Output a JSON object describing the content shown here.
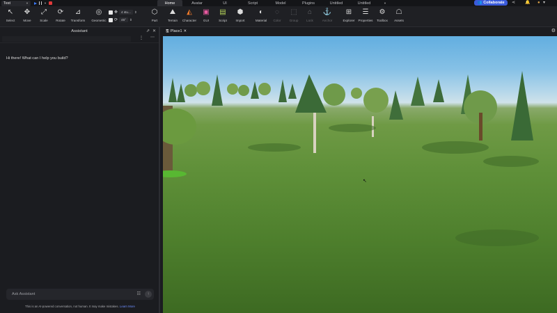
{
  "topbar": {
    "mode": "Test",
    "tabs": [
      {
        "label": "Home",
        "active": true
      },
      {
        "label": "Avatar",
        "active": false
      },
      {
        "label": "UI",
        "active": false
      },
      {
        "label": "Script",
        "active": false
      },
      {
        "label": "Model",
        "active": false
      },
      {
        "label": "Plugins",
        "active": false
      },
      {
        "label": "Untitled",
        "active": false
      },
      {
        "label": "Untitled",
        "active": false
      }
    ],
    "collaborate_label": "Collaborate"
  },
  "ribbon": {
    "tools": [
      {
        "label": "Select",
        "icon": "cursor-icon"
      },
      {
        "label": "Move",
        "icon": "move-arrows-icon"
      },
      {
        "label": "Scale",
        "icon": "scale-icon"
      },
      {
        "label": "Rotate",
        "icon": "rotate-icon"
      },
      {
        "label": "Transform",
        "icon": "transform-icon"
      },
      {
        "label": "Geometric",
        "icon": "geometric-icon"
      },
      {
        "label": "Part",
        "icon": "part-cube-icon"
      },
      {
        "label": "Terrain",
        "icon": "terrain-icon"
      },
      {
        "label": "Character",
        "icon": "character-icon"
      },
      {
        "label": "GUI",
        "icon": "gui-icon"
      },
      {
        "label": "Script",
        "icon": "script-icon"
      },
      {
        "label": "Import",
        "icon": "import-icon"
      },
      {
        "label": "Material",
        "icon": "material-icon"
      },
      {
        "label": "Color",
        "icon": "color-icon"
      },
      {
        "label": "Group",
        "icon": "group-icon"
      },
      {
        "label": "Lock",
        "icon": "lock-icon"
      },
      {
        "label": "Anchor",
        "icon": "anchor-icon"
      },
      {
        "label": "Explorer",
        "icon": "explorer-icon"
      },
      {
        "label": "Properties",
        "icon": "properties-icon"
      },
      {
        "label": "Toolbox",
        "icon": "toolbox-icon"
      },
      {
        "label": "Assets",
        "icon": "assets-icon"
      }
    ],
    "snap_move_value": "4 stu...",
    "snap_rotate_value": "45°"
  },
  "assistant": {
    "title": "Assistant",
    "greeting": "Hi there! What can I help you build?",
    "input_placeholder": "Ask Assistant",
    "disclaimer": "This is an AI-powered conversation, not human. It may make mistakes.",
    "learn_more": "Learn More"
  },
  "viewport": {
    "tab_label": "Place1"
  },
  "colors": {
    "accent": "#3b5bdb",
    "sky": "#86c1e6",
    "grass": "#5e8f38"
  }
}
